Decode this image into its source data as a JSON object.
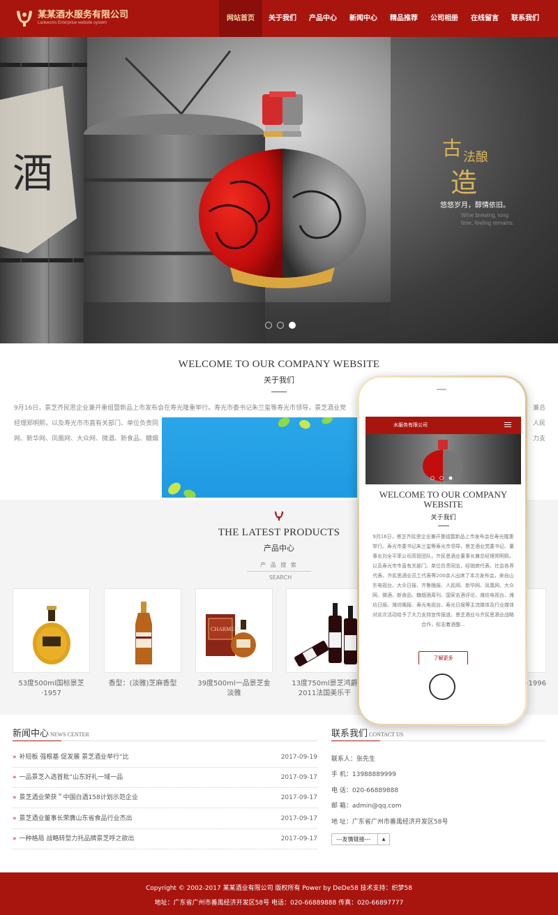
{
  "header": {
    "company_name": "某某酒水服务有限公司",
    "company_name_en": "Lankecms Enterprise website system",
    "nav": [
      "网站首页",
      "关于我们",
      "产品中心",
      "新闻中心",
      "精品推荐",
      "公司相册",
      "在线留言",
      "联系我们"
    ],
    "active_nav": "网站首页"
  },
  "banner": {
    "wall_char": "酒",
    "slogan_1": "古",
    "slogan_2": "法酿",
    "slogan_3": "造",
    "tagline": "悠悠岁月，醇情依旧。",
    "tagline_en": "Wine brewing, long time, feeling remains.",
    "slides": 3,
    "active_slide": 3
  },
  "about": {
    "title": "WELCOME TO OUR COMPANY WEBSITE",
    "subtitle": "关于我们",
    "text_line1": "9月16日，景芝齐民思企业兼开重组暨新品上市发布会在寿光隆重举行。寿光市委书记朱兰玺等寿光市领导，景芝酒业党",
    "text_line1_end": "兼总",
    "text_line2": "经理郑明熙，以及寿光市市直有关部门、单位负责同",
    "text_line2_end": "人民",
    "text_line3": "网、新华网、凤凰网、大众网、微酒、新食品、糖烟",
    "text_line3_end": "力支"
  },
  "products": {
    "title": "THE LATEST PRODUCTS",
    "subtitle": "产品中心",
    "search_label": "产 品 搜 索",
    "search_en": "SEARCH",
    "items": [
      {
        "caption": "53度500ml国标景芝·1957"
      },
      {
        "caption": "香型：(淡雅)芝麻香型"
      },
      {
        "caption": "39度500ml一品景芝金淡雅",
        "label": "CHARME XO"
      },
      {
        "caption": "13度750ml景芝鸿爵2011法国美乐干"
      },
      {
        "caption": ""
      },
      {
        "caption": "·1996"
      }
    ]
  },
  "phone": {
    "company_name": "水服务有限公司",
    "title": "WELCOME TO OUR COMPANY WEBSITE",
    "subtitle": "关于我们",
    "text": "9月16日，景芝齐民思企业兼开重组暨新品上市发布会在寿光隆重举行。寿光市委书记朱兰玺等寿光市领导，景芝酒业党委书记、董事长刘全平率公司高管团队，齐民思酒业董事长兼总经理郑明熙，以及寿光市市直有关部门、单位负责同志，经销商代表、社会各界代表、齐民思酒业员工代表等200余人出席了本次发布会。来自山东电视台、大众日报、齐鲁晚报、人民网、新华网、凤凰网、大众网、微酒、新食品、糖烟酒周刊、国家名酒评论、潍坊电视台、潍坊日报、潍坊晚报、寿光电视台、寿光日报等主流媒体及行业媒体对此次活动给予了大力支持宣传报道。景芝酒业与齐民思酒业战略合作，标志着酒整...",
    "button": "了解更多"
  },
  "news": {
    "title": "新闻中心",
    "title_en": "NEWS CENTER",
    "items": [
      {
        "title": "补短板 强根基 促发展 景芝酒业举行“比",
        "date": "2017-09-19"
      },
      {
        "title": "一品景芝入选首批“山东好礼一域一品",
        "date": "2017-09-17"
      },
      {
        "title": "景芝酒业荣获＂中国白酒158计划示范企业",
        "date": "2017-09-17"
      },
      {
        "title": "景芝酒业董事长荣膺山东省食品行业杰出",
        "date": "2017-09-17"
      },
      {
        "title": "一种格局 战略转型力托品牌景芝呼之欲出",
        "date": "2017-09-17"
      }
    ]
  },
  "contact": {
    "title": "联系我们",
    "title_en": "CONTACT US",
    "person": "联系人：张先生",
    "mobile": "手 机：13988889999",
    "phone": "电 话：020-66889888",
    "email": "邮 箱：admin@qq.com",
    "address": "地 址：广东省广州市番禺经济开发区58号",
    "links_select": "---友情链接---"
  },
  "footer": {
    "line1": "Copyright © 2002-2017 某某酒业有限公司 版权所有 Power by DeDe58 技术支持：织梦58",
    "line2": "地址：广东省广州市番禺经济开发区58号 电话：020-66889888 传真：020-66897777"
  },
  "colors": {
    "brand_red": "#a8150f",
    "gold": "#d8b45a",
    "ad_blue": "#1f9ae3"
  }
}
